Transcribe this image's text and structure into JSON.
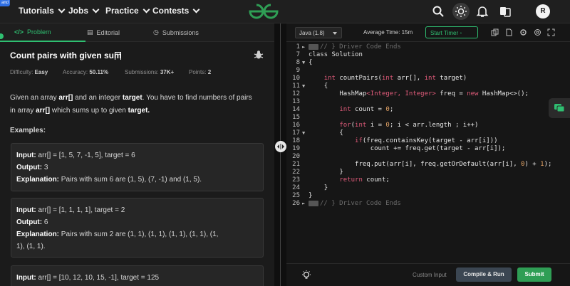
{
  "nav": {
    "badge": "and",
    "items": [
      "Tutorials",
      "Jobs",
      "Practice",
      "Contests"
    ],
    "avatar_letter": "R"
  },
  "tabs": [
    {
      "label": "Problem"
    },
    {
      "label": "Editorial"
    },
    {
      "label": "Submissions"
    }
  ],
  "problem": {
    "title": "Count pairs with given sum",
    "difficulty_label": "Difficulty:",
    "difficulty": "Easy",
    "accuracy_label": "Accuracy:",
    "accuracy": "50.11%",
    "submissions_label": "Submissions:",
    "submissions": "37K+",
    "points_label": "Points:",
    "points": "2",
    "desc1_a": "Given an array ",
    "desc1_b": "arr[]",
    "desc1_c": " and an integer ",
    "desc1_d": "target",
    "desc1_e": ". You have to find numbers of pairs",
    "desc2_a": "in array ",
    "desc2_b": "arr[]",
    "desc2_c": " which sums up to given ",
    "desc2_d": "target.",
    "examples_heading": "Examples:"
  },
  "examples": [
    {
      "input_label": "Input:",
      "input": " arr[] = [1, 5, 7, -1, 5], target = 6",
      "output_label": "Output:",
      "output": " 3",
      "explanation_label": "Explanation:",
      "explanation": " Pairs with sum 6 are (1, 5), (7, -1) and (1, 5)."
    },
    {
      "input_label": "Input:",
      "input": " arr[] = [1, 1, 1, 1], target = 2",
      "output_label": "Output:",
      "output": " 6",
      "explanation_label": "Explanation:",
      "explanation": " Pairs with sum 2 are (1, 1), (1, 1), (1, 1), (1, 1), (1,",
      "explanation2": "1), (1, 1)."
    },
    {
      "input_label": "Input:",
      "input": " arr[] = [10, 12, 10, 15, -1], target = 125"
    }
  ],
  "editor": {
    "language": "Java (1.8)",
    "avg_time": "Average Time: 15m",
    "timer": "Start Timer",
    "custom_input": "Custom Input",
    "compile": "Compile & Run",
    "submit": "Submit"
  },
  "code": {
    "line_numbers": [
      "1",
      "7",
      "8",
      "9",
      "10",
      "11",
      "12",
      "13",
      "14",
      "15",
      "16",
      "17",
      "18",
      "19",
      "20",
      "21",
      "22",
      "23",
      "24",
      "25",
      "26"
    ],
    "l1": "// } Driver Code Ends",
    "l7a": "class",
    "l7b": " Solution",
    "l8": "{",
    "l9a": "int",
    "l9b": " countPairs(",
    "l9c": "int",
    "l9d": " arr[], ",
    "l9e": "int",
    "l9f": " target)",
    "l10": "{",
    "l11a": "HashMap",
    "l11b": "<Integer, Integer>",
    "l11c": " freq = ",
    "l11d": "new",
    "l11e": " HashMap<>();",
    "l13a": "int",
    "l13b": " count = ",
    "l13c": "0",
    "l13d": ";",
    "l15a": "for",
    "l15b": "(",
    "l15c": "int",
    "l15d": " i = ",
    "l15e": "0",
    "l15f": "; i < arr.length ; i++)",
    "l16": "{",
    "l17a": "if",
    "l17b": "(freq.containsKey(target - arr[i]))",
    "l18": "count += freq.get(target - arr[i]);",
    "l20a": "freq.put(arr[i], freq.getOrDefault(arr[i], ",
    "l20b": "0",
    "l20c": ") + ",
    "l20d": "1",
    "l20e": ");",
    "l21": "}",
    "l22a": "return",
    "l22b": " count;",
    "l23": "}",
    "l24": "}",
    "l26": "// } Driver Code Ends"
  }
}
